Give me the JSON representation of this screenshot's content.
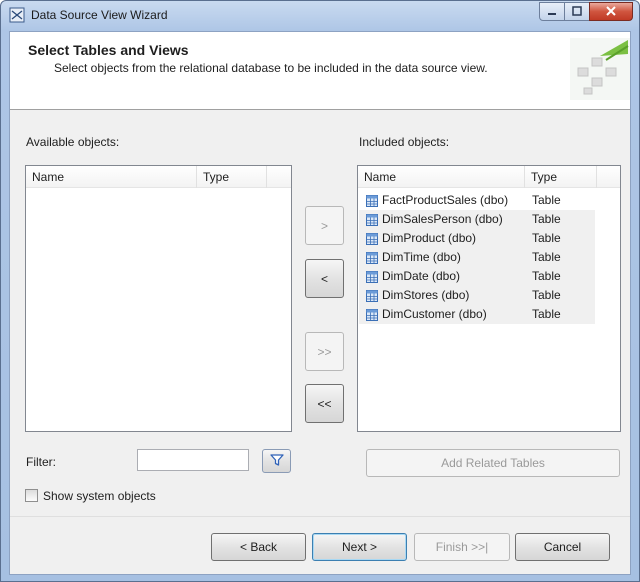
{
  "window": {
    "title": "Data Source View Wizard",
    "caption_buttons": [
      "minimize-icon",
      "maximize-icon",
      "close-icon"
    ]
  },
  "header": {
    "title": "Select Tables and Views",
    "subtitle": "Select objects from the relational database to be included in the data source view."
  },
  "available": {
    "label": "Available objects:",
    "columns": [
      "Name",
      "Type"
    ],
    "rows": []
  },
  "included": {
    "label": "Included objects:",
    "columns": [
      "Name",
      "Type"
    ],
    "rows": [
      {
        "name": "FactProductSales (dbo)",
        "type": "Table"
      },
      {
        "name": "DimSalesPerson (dbo)",
        "type": "Table"
      },
      {
        "name": "DimProduct (dbo)",
        "type": "Table"
      },
      {
        "name": "DimTime (dbo)",
        "type": "Table"
      },
      {
        "name": "DimDate (dbo)",
        "type": "Table"
      },
      {
        "name": "DimStores (dbo)",
        "type": "Table"
      },
      {
        "name": "DimCustomer (dbo)",
        "type": "Table"
      }
    ]
  },
  "move_buttons": {
    "add": ">",
    "remove": "<",
    "add_all": ">>",
    "remove_all": "<<"
  },
  "filter": {
    "label": "Filter:",
    "value": ""
  },
  "add_related_label": "Add Related Tables",
  "show_system_label": "Show system objects",
  "show_system_checked": false,
  "footer": {
    "back": "< Back",
    "next": "Next >",
    "finish": "Finish >>|",
    "cancel": "Cancel"
  },
  "colors": {
    "accent": "#3c7fb1",
    "client_bg": "#f0f0f0",
    "titlebar": "#aec6e6"
  }
}
